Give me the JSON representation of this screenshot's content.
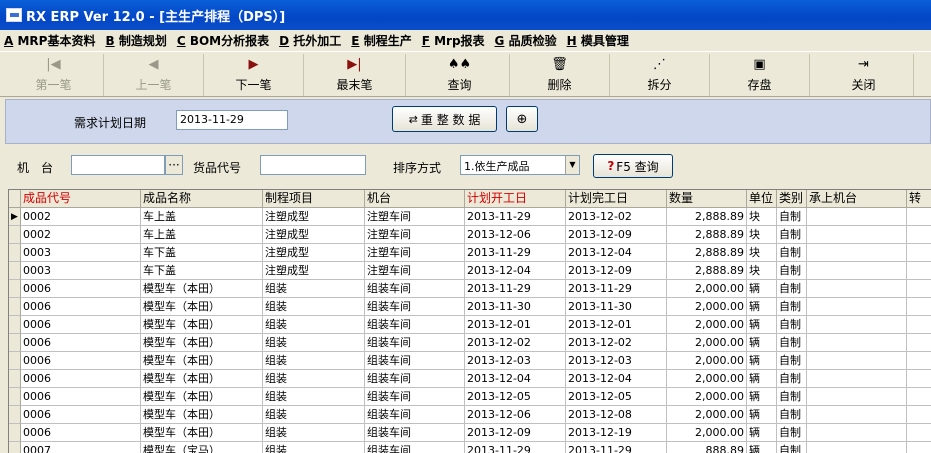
{
  "window": {
    "title": "RX ERP Ver 12.0 - [主生产排程（DPS）]"
  },
  "menu": [
    {
      "key": "A",
      "label": "MRP基本资料"
    },
    {
      "key": "B",
      "label": "制造规划"
    },
    {
      "key": "C",
      "label": "BOM分析报表"
    },
    {
      "key": "D",
      "label": "托外加工"
    },
    {
      "key": "E",
      "label": "制程生产"
    },
    {
      "key": "F",
      "label": "Mrp报表"
    },
    {
      "key": "G",
      "label": "品质检验"
    },
    {
      "key": "H",
      "label": "模具管理"
    }
  ],
  "toolbar": {
    "first": {
      "label": "第一笔",
      "icon": "first-record-icon",
      "glyph": "|◀"
    },
    "prev": {
      "label": "上一笔",
      "icon": "prev-record-icon",
      "glyph": "◀"
    },
    "next": {
      "label": "下一笔",
      "icon": "next-record-icon",
      "glyph": "▶"
    },
    "last": {
      "label": "最末笔",
      "icon": "last-record-icon",
      "glyph": "▶|"
    },
    "query": {
      "label": "查询",
      "icon": "binoculars-icon",
      "glyph": "♠♠"
    },
    "delete": {
      "label": "删除",
      "icon": "trash-icon",
      "glyph": "🗑"
    },
    "split": {
      "label": "拆分",
      "icon": "split-icon",
      "glyph": "⋰"
    },
    "save": {
      "label": "存盘",
      "icon": "save-icon",
      "glyph": "▣"
    },
    "close": {
      "label": "关闭",
      "icon": "exit-icon",
      "glyph": "⇥"
    }
  },
  "filters": {
    "plan_date_label": "需求计划日期",
    "plan_date_value": "2013-11-29",
    "rebuild_label": "重 整 数 据",
    "machine_label": "机　台",
    "machine_value": "",
    "machine_browse": "···",
    "product_label": "货品代号",
    "product_value": "",
    "sort_label": "排序方式",
    "sort_value": "1.依生产成品",
    "query_label": "F5 查询",
    "query_prefix": "?"
  },
  "table": {
    "columns": [
      "成品代号",
      "成品名称",
      "制程项目",
      "机台",
      "计划开工日",
      "计划完工日",
      "数量",
      "单位",
      "类别",
      "承上机台",
      "转"
    ],
    "highlight_columns": [
      0,
      4
    ],
    "highlight_color": "#d40000",
    "selected_row": 0,
    "rows": [
      [
        "0002",
        "车上盖",
        "注塑成型",
        "注塑车间",
        "2013-11-29",
        "2013-12-02",
        "2,888.89",
        "块",
        "自制",
        "",
        ""
      ],
      [
        "0002",
        "车上盖",
        "注塑成型",
        "注塑车间",
        "2013-12-06",
        "2013-12-09",
        "2,888.89",
        "块",
        "自制",
        "",
        ""
      ],
      [
        "0003",
        "车下盖",
        "注塑成型",
        "注塑车间",
        "2013-11-29",
        "2013-12-04",
        "2,888.89",
        "块",
        "自制",
        "",
        ""
      ],
      [
        "0003",
        "车下盖",
        "注塑成型",
        "注塑车间",
        "2013-12-04",
        "2013-12-09",
        "2,888.89",
        "块",
        "自制",
        "",
        ""
      ],
      [
        "0006",
        "模型车（本田）",
        "组装",
        "组装车间",
        "2013-11-29",
        "2013-11-29",
        "2,000.00",
        "辆",
        "自制",
        "",
        ""
      ],
      [
        "0006",
        "模型车（本田）",
        "组装",
        "组装车间",
        "2013-11-30",
        "2013-11-30",
        "2,000.00",
        "辆",
        "自制",
        "",
        ""
      ],
      [
        "0006",
        "模型车（本田）",
        "组装",
        "组装车间",
        "2013-12-01",
        "2013-12-01",
        "2,000.00",
        "辆",
        "自制",
        "",
        ""
      ],
      [
        "0006",
        "模型车（本田）",
        "组装",
        "组装车间",
        "2013-12-02",
        "2013-12-02",
        "2,000.00",
        "辆",
        "自制",
        "",
        ""
      ],
      [
        "0006",
        "模型车（本田）",
        "组装",
        "组装车间",
        "2013-12-03",
        "2013-12-03",
        "2,000.00",
        "辆",
        "自制",
        "",
        ""
      ],
      [
        "0006",
        "模型车（本田）",
        "组装",
        "组装车间",
        "2013-12-04",
        "2013-12-04",
        "2,000.00",
        "辆",
        "自制",
        "",
        ""
      ],
      [
        "0006",
        "模型车（本田）",
        "组装",
        "组装车间",
        "2013-12-05",
        "2013-12-05",
        "2,000.00",
        "辆",
        "自制",
        "",
        ""
      ],
      [
        "0006",
        "模型车（本田）",
        "组装",
        "组装车间",
        "2013-12-06",
        "2013-12-08",
        "2,000.00",
        "辆",
        "自制",
        "",
        ""
      ],
      [
        "0006",
        "模型车（本田）",
        "组装",
        "组装车间",
        "2013-12-09",
        "2013-12-19",
        "2,000.00",
        "辆",
        "自制",
        "",
        ""
      ],
      [
        "0007",
        "模型车（宝马）",
        "组装",
        "组装车间",
        "2013-11-29",
        "2013-11-29",
        "888.89",
        "辆",
        "自制",
        "",
        ""
      ]
    ]
  }
}
